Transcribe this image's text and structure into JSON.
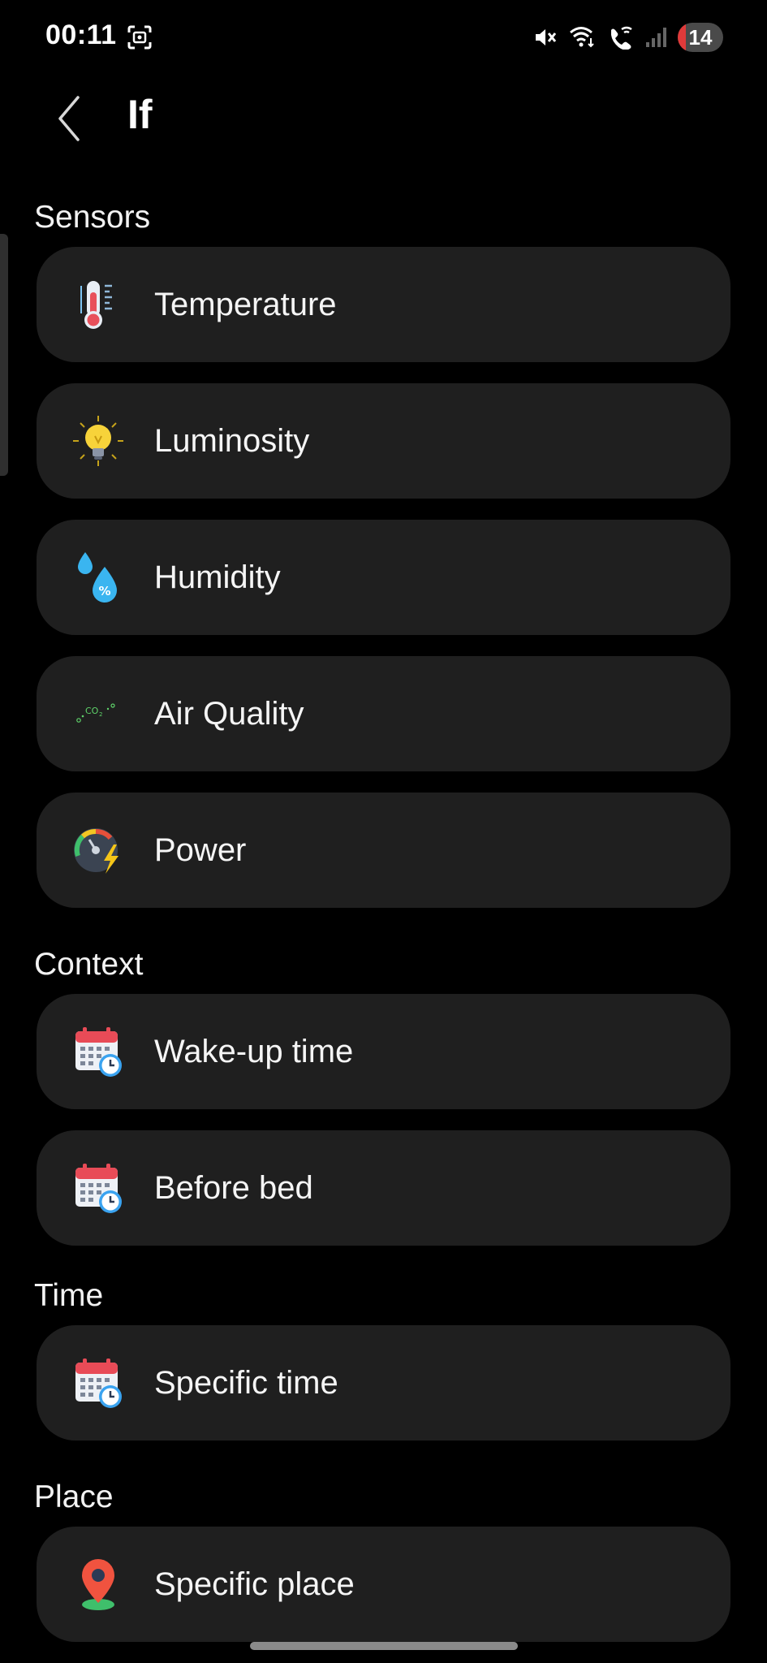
{
  "status_bar": {
    "time": "00:11",
    "battery_level": "14"
  },
  "header": {
    "title": "If"
  },
  "sections": {
    "sensors": {
      "title": "Sensors",
      "items": [
        {
          "label": "Temperature",
          "icon": "thermometer-icon"
        },
        {
          "label": "Luminosity",
          "icon": "light-bulb-icon"
        },
        {
          "label": "Humidity",
          "icon": "water-drops-icon"
        },
        {
          "label": "Air Quality",
          "icon": "co2-icon"
        },
        {
          "label": "Power",
          "icon": "power-gauge-icon"
        }
      ]
    },
    "context": {
      "title": "Context",
      "items": [
        {
          "label": "Wake-up time",
          "icon": "calendar-clock-icon"
        },
        {
          "label": "Before bed",
          "icon": "calendar-clock-icon"
        }
      ]
    },
    "time": {
      "title": "Time",
      "items": [
        {
          "label": "Specific time",
          "icon": "calendar-clock-icon"
        }
      ]
    },
    "place": {
      "title": "Place",
      "items": [
        {
          "label": "Specific place",
          "icon": "location-pin-icon"
        }
      ]
    }
  },
  "colors": {
    "background": "#000000",
    "card": "#1f1f1f",
    "text": "#f5f5f5",
    "battery_low": "#e03a3a"
  }
}
